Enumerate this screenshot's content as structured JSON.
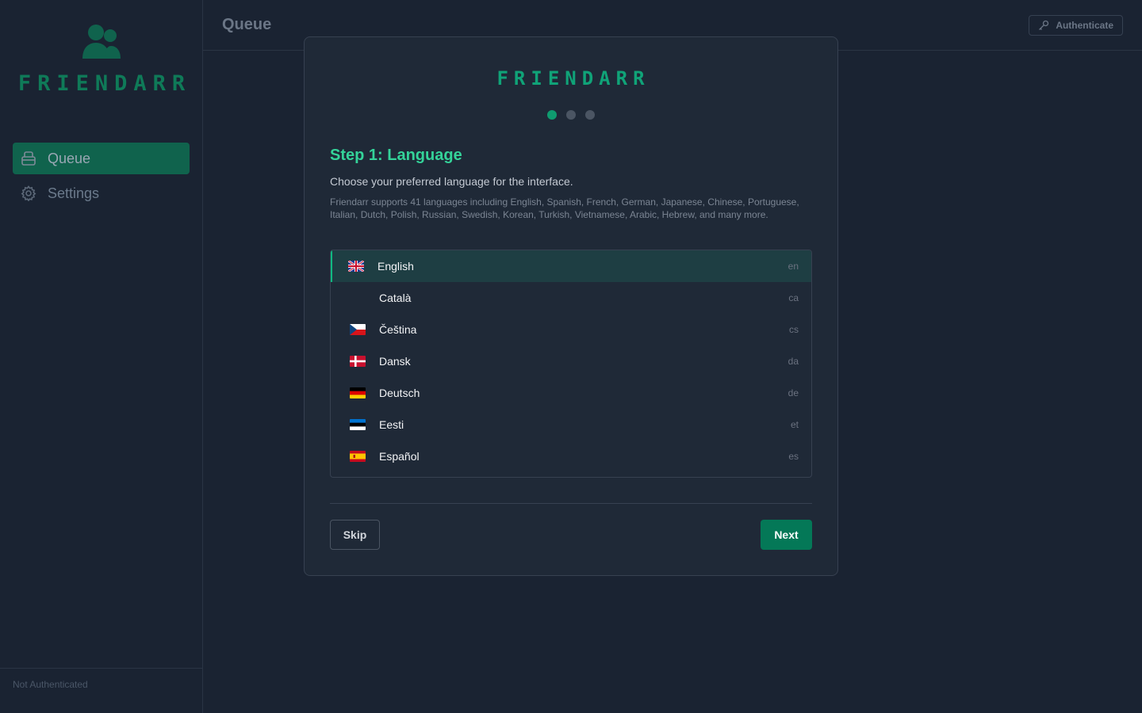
{
  "sidebar": {
    "brand": "FRIENDARR",
    "nav": [
      {
        "label": "Queue",
        "icon": "inbox-icon",
        "active": true
      },
      {
        "label": "Settings",
        "icon": "gear-icon",
        "active": false
      }
    ],
    "footer": "Not Authenticated"
  },
  "header": {
    "title": "Queue",
    "auth_button": "Authenticate",
    "auth_icon": "key-icon"
  },
  "wizard": {
    "logo": "FRIENDARR",
    "steps_total": 3,
    "current_step": 1,
    "title": "Step 1: Language",
    "subtitle": "Choose your preferred language for the interface.",
    "description": "Friendarr supports 41 languages including English, Spanish, French, German, Japanese, Chinese, Portuguese, Italian, Dutch, Polish, Russian, Swedish, Korean, Turkish, Vietnamese, Arabic, Hebrew, and many more.",
    "languages": [
      {
        "name": "English",
        "code": "en",
        "flag": "uk-flag-icon",
        "selected": true
      },
      {
        "name": "Català",
        "code": "ca",
        "flag": "",
        "selected": false
      },
      {
        "name": "Čeština",
        "code": "cs",
        "flag": "czech-flag-icon",
        "selected": false
      },
      {
        "name": "Dansk",
        "code": "da",
        "flag": "danish-flag-icon",
        "selected": false
      },
      {
        "name": "Deutsch",
        "code": "de",
        "flag": "german-flag-icon",
        "selected": false
      },
      {
        "name": "Eesti",
        "code": "et",
        "flag": "estonian-flag-icon",
        "selected": false
      },
      {
        "name": "Español",
        "code": "es",
        "flag": "spanish-flag-icon",
        "selected": false
      }
    ],
    "skip_label": "Skip",
    "next_label": "Next"
  },
  "colors": {
    "accent": "#10b981",
    "brand": "#10a378",
    "primary_button": "#047857",
    "background": "#1a2332",
    "card": "#1f2937"
  }
}
